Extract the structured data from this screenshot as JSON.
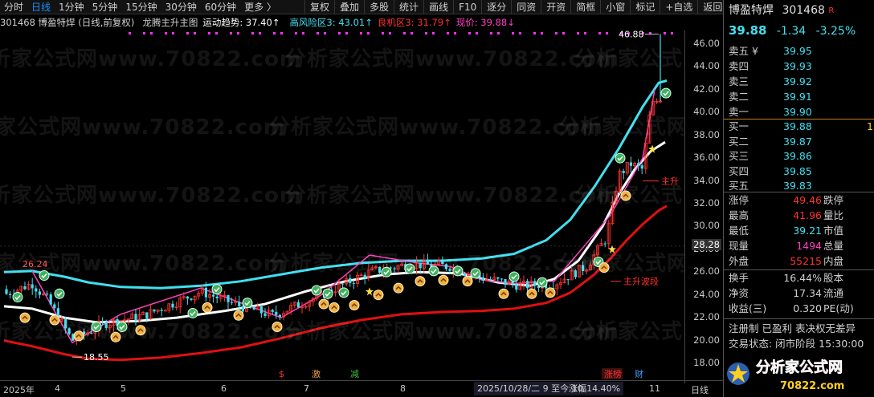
{
  "toolbar": {
    "periods": [
      "分时",
      "日线",
      "1分钟",
      "5分钟",
      "15分钟",
      "30分钟",
      "60分钟",
      "更多 〉"
    ],
    "active_period": "日线",
    "buttons": [
      "复权",
      "叠加",
      "多股",
      "统计",
      "画线",
      "F10",
      "逐分",
      "同资",
      "开资",
      "简框",
      "小窗",
      "标记",
      "+自选",
      "返回"
    ]
  },
  "infobar": {
    "code_name": "301468 博盈特焊 (日线,前复权)",
    "indicator": "龙腾主升主图",
    "trend": "运动趋势: 37.40↑",
    "risk": "高风险区3: 43.01↑",
    "good": "良机区3: 31.79↑",
    "price": "现价: 39.88↓"
  },
  "price_axis": [
    "46.00",
    "44.00",
    "42.00",
    "40.00",
    "38.00",
    "36.00",
    "34.00",
    "32.00",
    "30.00",
    "28.00",
    "26.00",
    "24.00",
    "22.00",
    "20.00",
    "18.00"
  ],
  "crosshair_price": "28.28",
  "x_axis": [
    "2025年",
    "4",
    "5",
    "6",
    "7",
    "8",
    "10",
    "11",
    "日线"
  ],
  "status_line": "2025/10/28/二  9  至今涨幅14.40%",
  "annotations": {
    "high_label": "46.88",
    "peak_left": "26.24",
    "low_label": "18.55",
    "main_rise": "主升",
    "main_rise_wave": "主升波段"
  },
  "event_marks": [
    "$",
    "激",
    "减",
    "涨榜",
    "财"
  ],
  "watermark": "分析家公式网www.70822.com",
  "brand": {
    "name": "分析家公式网",
    "url": "70822.com"
  },
  "stock": {
    "name": "博盈特焊",
    "code": "301468",
    "flag": "R",
    "price": "39.88",
    "change": "-1.34",
    "change_pct": "-3.25%"
  },
  "asks": [
    {
      "label": "卖五 ¥",
      "price": "39.95"
    },
    {
      "label": "卖四",
      "price": "39.93"
    },
    {
      "label": "卖三",
      "price": "39.92"
    },
    {
      "label": "卖二",
      "price": "39.91"
    },
    {
      "label": "卖一",
      "price": "39.90"
    }
  ],
  "bids": [
    {
      "label": "买一",
      "price": "39.88",
      "vol": "1"
    },
    {
      "label": "买二",
      "price": "39.87"
    },
    {
      "label": "买三",
      "price": "39.86"
    },
    {
      "label": "买四",
      "price": "39.85"
    },
    {
      "label": "买五",
      "price": "39.83"
    }
  ],
  "stats1": [
    {
      "l1": "涨停",
      "v1": "49.46",
      "l2": "跌停"
    },
    {
      "l1": "最高",
      "v1": "41.96",
      "l2": "量比"
    },
    {
      "l1": "最低",
      "v1": "39.21",
      "l2": "市值"
    },
    {
      "l1": "现量",
      "v1": "1494",
      "l2": "总量"
    },
    {
      "l1": "外盘",
      "v1": "55215",
      "l2": "内盘"
    }
  ],
  "stats2": [
    {
      "l1": "换手",
      "v1": "16.44%",
      "l2": "股本"
    },
    {
      "l1": "净资",
      "v1": "17.34",
      "l2": "流通"
    },
    {
      "l1": "收益(三)",
      "v1": "0.320",
      "l2": "PE(动)"
    }
  ],
  "registration": "注册制  已盈利  表决权无差异",
  "trade_status": "交易状态: 闭市阶段 15:30:00",
  "colors": {
    "up": "#ff3333",
    "down": "#00ffff",
    "bg": "#000000",
    "cyan_line": "#40e0f0",
    "red_band": "#e01010",
    "magenta": "#ff40c0"
  }
}
